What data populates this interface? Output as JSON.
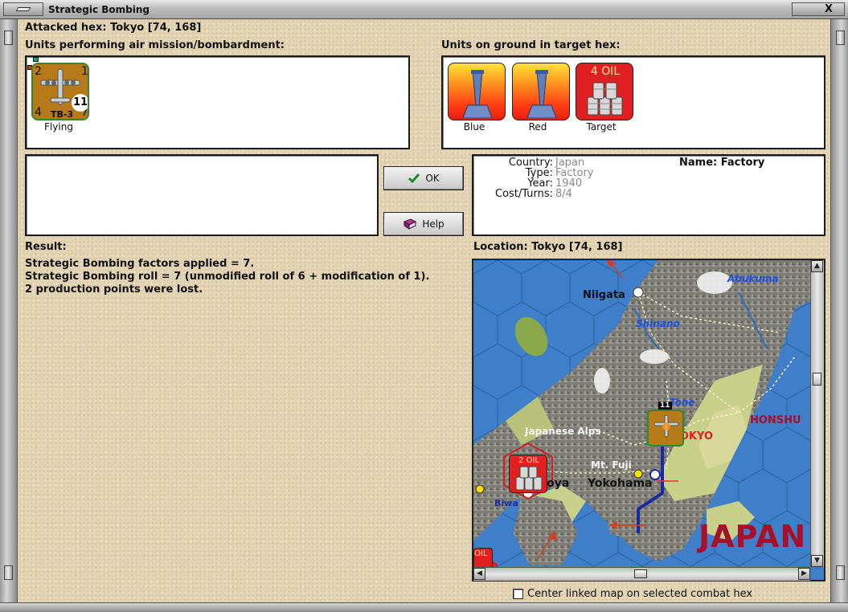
{
  "window": {
    "title": "Strategic Bombing",
    "close_glyph": "X"
  },
  "attacked_hex": "Attacked hex: Tokyo  [74, 168]",
  "air_units": {
    "label": "Units performing air mission/bombardment:",
    "items": [
      {
        "name": "Flying",
        "type": "TB-3",
        "top_left": "2",
        "top_right": "1",
        "bottom_left": "4",
        "bottom_right": "7",
        "circle": "11",
        "color": "#b67a18"
      }
    ]
  },
  "ground_units": {
    "label": "Units on ground in target hex:",
    "items": [
      {
        "name": "Blue",
        "kind": "factory-icon"
      },
      {
        "name": "Red",
        "kind": "factory-icon"
      },
      {
        "name": "Target",
        "kind": "oil-barrels-icon",
        "text": "4 OIL"
      }
    ]
  },
  "buttons": {
    "ok": "OK",
    "help": "Help"
  },
  "info": {
    "country_label": "Country:",
    "country": "Japan",
    "type_label": "Type:",
    "type": "Factory",
    "year_label": "Year:",
    "year": "1940",
    "cost_label": "Cost/Turns:",
    "cost": "8/4",
    "name": "Name: Factory"
  },
  "result": {
    "label": "Result:",
    "lines": [
      "Strategic Bombing factors applied = 7.",
      "Strategic Bombing roll = 7 (unmodified roll of 6 + modification of 1).",
      "2 production points were lost."
    ]
  },
  "location": "Location:  Tokyo  [74, 168]",
  "map": {
    "labels": {
      "niigata": "Niigata",
      "abukuma": "Abukuma",
      "shinano": "Shinano",
      "tone": "Tone",
      "honshu": "HONSHU",
      "japanese_alps": "Japanese Alps",
      "tokyo": "TOKYO",
      "mt_fuji": "Mt. Fuji",
      "nagoya": "Nagoya",
      "yokohama": "Yokohama",
      "biwa": "Biwa",
      "japan": "JAPAN",
      "oil_counter": "2 OIL",
      "oil_edge": "OIL",
      "stack_count": "11"
    },
    "colors": {
      "sea": "#3f7fc9",
      "land": "#c9d08a",
      "mountain": "#7d7d76",
      "forest": "#8aa84a"
    }
  },
  "center_map_checkbox": {
    "label": "Center linked map on selected combat hex",
    "checked": false
  }
}
